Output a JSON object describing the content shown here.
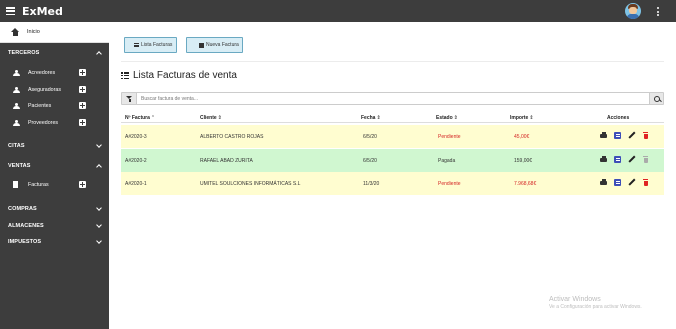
{
  "app": {
    "title": "ExMed"
  },
  "sidebar": {
    "home": "Inicio",
    "sections": [
      {
        "label": "TERCEROS",
        "expanded": true
      },
      {
        "label": "CITAS",
        "expanded": false
      },
      {
        "label": "VENTAS",
        "expanded": true
      },
      {
        "label": "COMPRAS",
        "expanded": false
      },
      {
        "label": "ALMACENES",
        "expanded": false
      },
      {
        "label": "IMPUESTOS",
        "expanded": false
      }
    ],
    "terceros_items": [
      {
        "label": "Acreedores",
        "icon": "person-icon"
      },
      {
        "label": "Aseguradoras",
        "icon": "person-icon"
      },
      {
        "label": "Pacientes",
        "icon": "people-icon"
      },
      {
        "label": "Proveedores",
        "icon": "person-icon"
      }
    ],
    "ventas_items": [
      {
        "label": "Facturas",
        "icon": "document-icon"
      }
    ]
  },
  "toolbar": {
    "list_label": "Lista Facturas",
    "new_label": "Nueva Factura"
  },
  "page": {
    "title": "Lista Facturas de venta"
  },
  "search": {
    "placeholder": "Buscar factura de venta..."
  },
  "table": {
    "headers": {
      "number": "Nº Factura",
      "client": "Cliente",
      "date": "Fecha",
      "status": "Estado",
      "amount": "Importe",
      "actions": "Acciones"
    },
    "rows": [
      {
        "number": "A#2020-3",
        "client": "ALBERTO CASTRO ROJAS",
        "date": "6/5/20",
        "status": "Pendiente",
        "amount": "45,00€"
      },
      {
        "number": "A#2020-2",
        "client": "RAFAEL ABAD ZURITA",
        "date": "6/5/20",
        "status": "Pagada",
        "amount": "159,00€"
      },
      {
        "number": "A#2020-1",
        "client": "UMITEL SOULCIONES INFORMÁTICAS S.L",
        "date": "11/3/20",
        "status": "Pendiente",
        "amount": "7.968,68€"
      }
    ]
  },
  "colors": {
    "topbar": "#3d3d3d",
    "pending_row": "#fffdd0",
    "paid_row": "#d0f7d0",
    "pending_text": "#d42525",
    "pdf_icon": "#3d4eb8",
    "delete_icon": "#e02424"
  },
  "watermark": {
    "line1": "Activar Windows",
    "line2": "Ve a Configuración para activar Windows."
  }
}
